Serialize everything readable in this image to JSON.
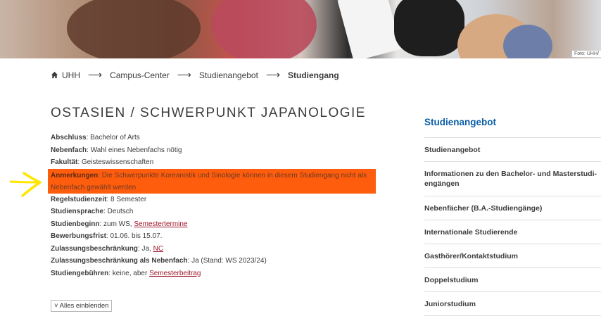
{
  "hero": {
    "photo_credit": "Foto: UHH/"
  },
  "breadcrumb": {
    "home": "UHH",
    "sep": "⟶",
    "items": [
      "Campus-Center",
      "Studienangebot"
    ],
    "current": "Studiengang"
  },
  "page_title": "OSTASIEN / SCHWERPUNKT JAPANOLOGIE",
  "facts": {
    "abschluss": {
      "label": "Abschluss",
      "value": "Bachelor of Arts"
    },
    "nebenfach": {
      "label": "Nebenfach",
      "value": "Wahl eines Nebenfachs nötig"
    },
    "fakultaet": {
      "label": "Fakultät",
      "value": "Geisteswissenschaften"
    },
    "anmerkungen": {
      "label": "Anmerkungen",
      "value": "Die Schwerpunkte Koreanistik und Sinologie können in diesem Studiengang nicht als Nebenfach gewählt werden"
    },
    "regelstudienzeit": {
      "label": "Regelstudienzeit",
      "value": "8 Semester"
    },
    "studiensprache": {
      "label": "Studiensprache",
      "value": "Deutsch"
    },
    "studienbeginn": {
      "label": "Studienbeginn",
      "value": "zum WS,",
      "link": "Semestertermine"
    },
    "bewerbungsfrist": {
      "label": "Bewerbungsfrist",
      "value": "01.06. bis 15.07."
    },
    "zulassung": {
      "label": "Zulassungsbeschränkung",
      "value": "Ja,",
      "link": "NC"
    },
    "zulassung_nebenfach": {
      "label": "Zulassungsbeschränkung als Nebenfach",
      "value": "Ja (Stand: WS 2023/24)"
    },
    "gebuehren": {
      "label": "Studiengebühren",
      "value": "keine, aber",
      "link": "Semesterbeitrag"
    }
  },
  "expand_button": "˅ Alles einblenden",
  "sidebar": {
    "title": "Studienangebot",
    "items": [
      "Studienangebot",
      "Informationen zu den Bachelor- und Masterstudi-engängen",
      "Nebenfächer (B.A.-Studiengänge)",
      "Internationale Studierende",
      "Gasthörer/Kontaktstudium",
      "Doppelstudium",
      "Juniorstudium"
    ]
  },
  "colors": {
    "accent_blue": "#0a5ea8",
    "link_red": "#a0162b",
    "highlight": "#ff5d0e",
    "annotation_arrow": "#ffe600"
  }
}
